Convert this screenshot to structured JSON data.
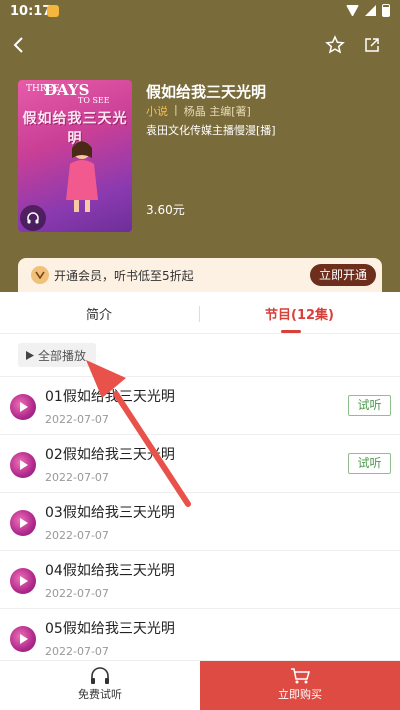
{
  "status_bar": {
    "time": "10:17"
  },
  "book": {
    "cover": {
      "title_en_prefix": "THREE",
      "title_en_main": "DAYS",
      "title_en_suffix": "TO SEE",
      "title_cn": "假如给我三天光明"
    },
    "title": "假如给我三天光明",
    "category": "小说",
    "author": "杨晶 主编[著]",
    "publisher": "袁田文化传媒主播慢漫[播]",
    "price": "3.60元"
  },
  "vip": {
    "text": "开通会员，听书低至5折起",
    "button": "立即开通"
  },
  "tabs": {
    "intro": "简介",
    "programs": "节目(12集)"
  },
  "play_all": "全部播放",
  "episodes": [
    {
      "title": "01假如给我三天光明",
      "date": "2022-07-07",
      "trial": "试听"
    },
    {
      "title": "02假如给我三天光明",
      "date": "2022-07-07",
      "trial": "试听"
    },
    {
      "title": "03假如给我三天光明",
      "date": "2022-07-07"
    },
    {
      "title": "04假如给我三天光明",
      "date": "2022-07-07"
    },
    {
      "title": "05假如给我三天光明",
      "date": "2022-07-07"
    }
  ],
  "bottom": {
    "free_listen": "免费试听",
    "buy_now": "立即购买"
  },
  "colors": {
    "header_bg": "#7a6b3a",
    "accent_red": "#d9403a",
    "buy_bg": "#de4b43",
    "vip_button": "#6e2e1c",
    "trial_green": "#4d9a4d"
  }
}
